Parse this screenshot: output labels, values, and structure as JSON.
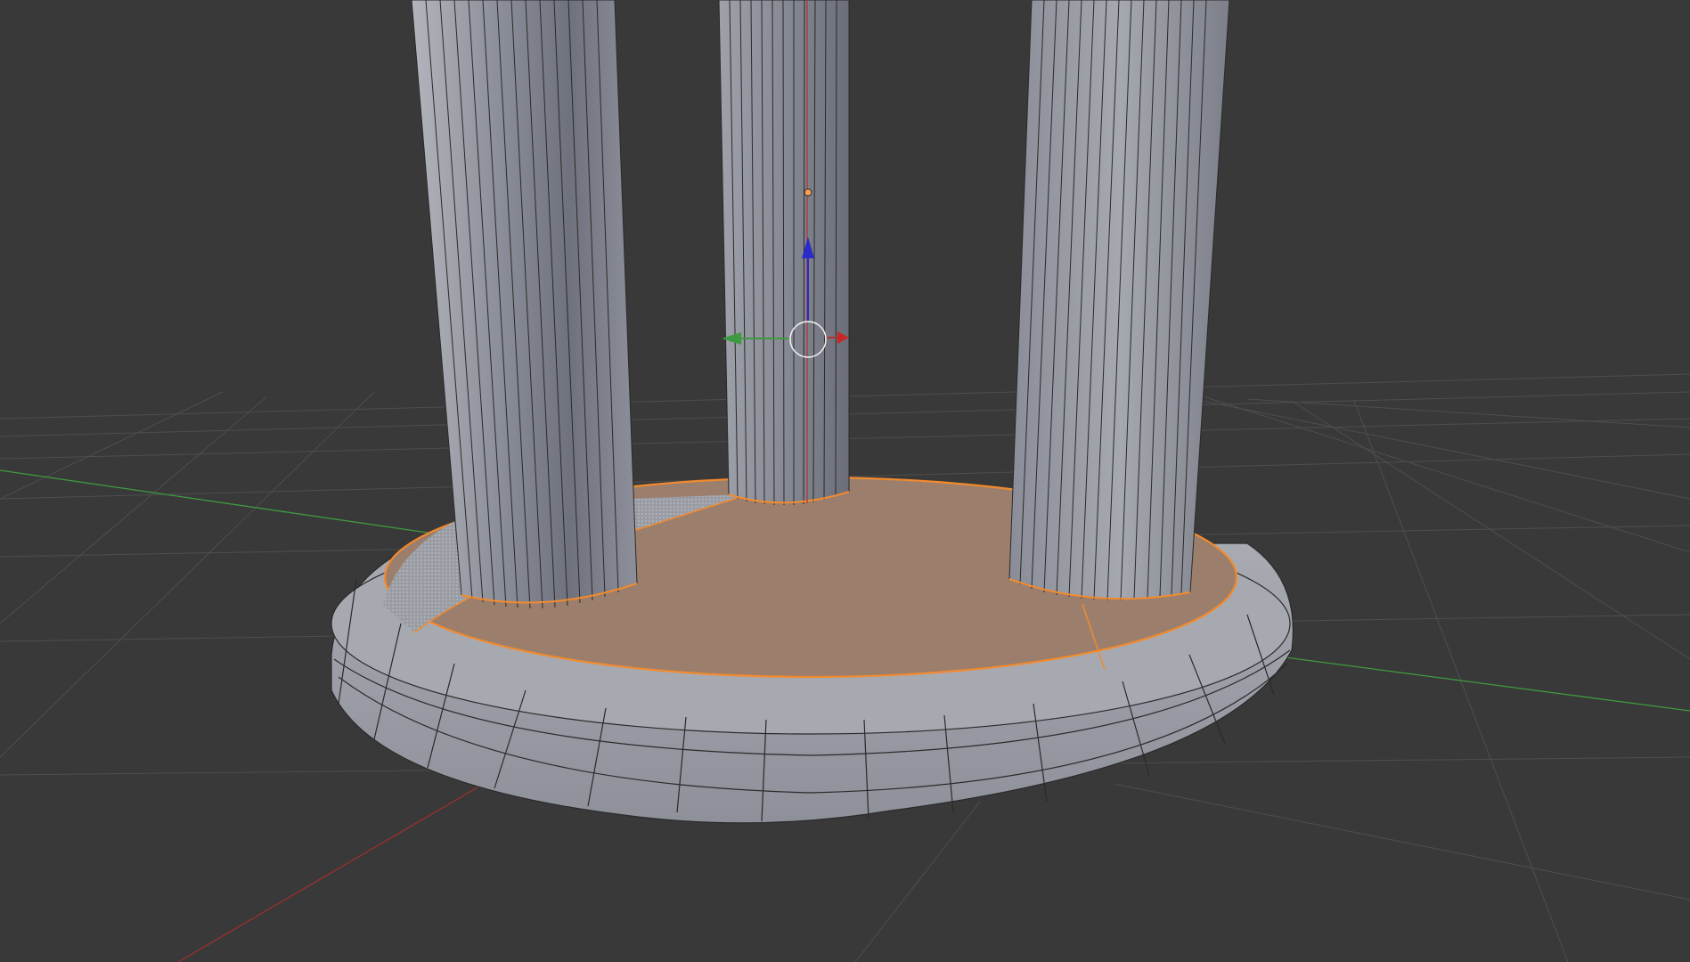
{
  "viewport": {
    "mode": "edit-mode",
    "shading": "solid",
    "background_color": "#393939",
    "grid_color": "#4d4d4d",
    "selection_color": "#f28a2e",
    "selected_face_color": "#9b7f6c",
    "mesh_color": "#9a9ca6"
  },
  "axes": {
    "x_axis_color": "#b03232",
    "y_axis_color": "#3e9a3e",
    "z_axis_color": "#2a2ac8"
  },
  "gizmo": {
    "type": "translate",
    "handles": [
      "x-arrow",
      "y-arrow",
      "z-arrow",
      "center-circle"
    ]
  },
  "scene": {
    "objects": [
      "column-left",
      "column-center",
      "column-right",
      "base-plinth"
    ]
  }
}
